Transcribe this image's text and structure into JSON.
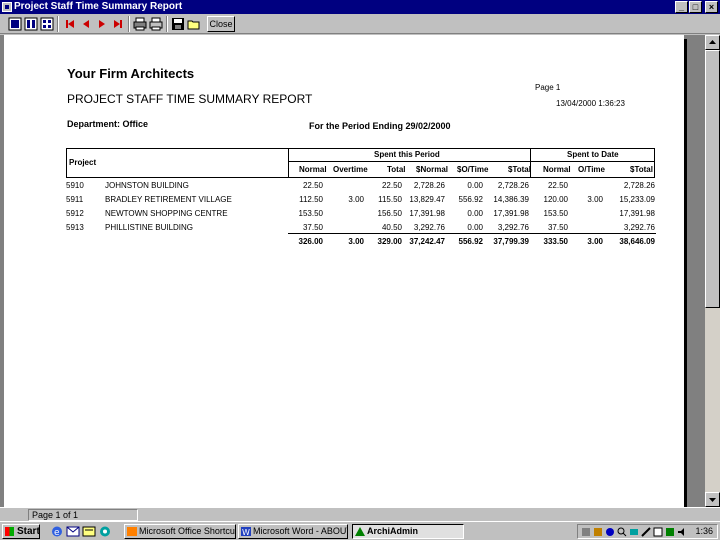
{
  "window": {
    "title": "Project Staff Time Summary Report"
  },
  "toolbar": {
    "close_label": "Close"
  },
  "status": {
    "page_text": "Page 1 of 1"
  },
  "report": {
    "firm": "Your Firm Architects",
    "title": "PROJECT STAFF TIME SUMMARY REPORT",
    "page": "Page 1",
    "timestamp": "13/04/2000 1:36:23",
    "department": "Department: Office",
    "period": "For the Period Ending  29/02/2000",
    "headers": {
      "project": "Project",
      "spent_period": "Spent this Period",
      "spent_date": "Spent to Date",
      "normal": "Normal",
      "overtime": "Overtime",
      "total": "Total",
      "snormal": "$Normal",
      "sotime": "$O/Time",
      "stotal": "$Total",
      "normal2": "Normal",
      "otime2": "O/Time",
      "stotal2": "$Total"
    },
    "rows": [
      {
        "code": "5910",
        "name": "JOHNSTON BUILDING",
        "normal": "22.50",
        "overtime": "",
        "total": "22.50",
        "snormal": "2,728.26",
        "sotime": "0.00",
        "stotal": "2,728.26",
        "normal2": "22.50",
        "otime2": "",
        "stotal2": "2,728.26"
      },
      {
        "code": "5911",
        "name": "BRADLEY RETIREMENT VILLAGE",
        "normal": "112.50",
        "overtime": "3.00",
        "total": "115.50",
        "snormal": "13,829.47",
        "sotime": "556.92",
        "stotal": "14,386.39",
        "normal2": "120.00",
        "otime2": "3.00",
        "stotal2": "15,233.09"
      },
      {
        "code": "5912",
        "name": "NEWTOWN SHOPPING CENTRE",
        "normal": "153.50",
        "overtime": "",
        "total": "156.50",
        "snormal": "17,391.98",
        "sotime": "0.00",
        "stotal": "17,391.98",
        "normal2": "153.50",
        "otime2": "",
        "stotal2": "17,391.98"
      },
      {
        "code": "5913",
        "name": "PHILLISTINE BUILDING",
        "normal": "37.50",
        "overtime": "",
        "total": "40.50",
        "snormal": "3,292.76",
        "sotime": "0.00",
        "stotal": "3,292.76",
        "normal2": "37.50",
        "otime2": "",
        "stotal2": "3,292.76"
      }
    ],
    "totals": {
      "normal": "326.00",
      "overtime": "3.00",
      "total": "329.00",
      "snormal": "37,242.47",
      "sotime": "556.92",
      "stotal": "37,799.39",
      "normal2": "333.50",
      "otime2": "3.00",
      "stotal2": "38,646.09"
    }
  },
  "taskbar": {
    "start": "Start",
    "tasks": [
      {
        "label": "Microsoft Office Shortcut Bar"
      },
      {
        "label": "Microsoft Word - ABOUT ..."
      },
      {
        "label": "ArchiAdmin"
      }
    ],
    "clock": "1:36"
  }
}
